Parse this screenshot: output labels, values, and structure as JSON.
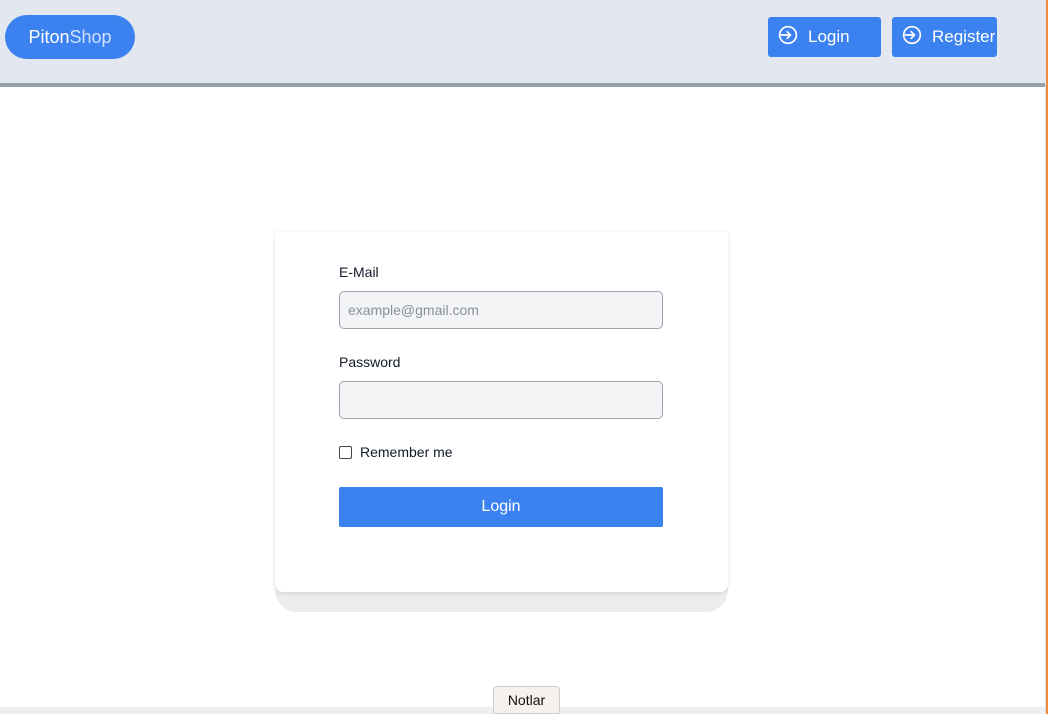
{
  "header": {
    "logo_part1": "Piton",
    "logo_part2": "Shop",
    "login_label": "Login",
    "register_label": "Register",
    "login_icon": "sign-in-icon",
    "register_icon": "sign-in-icon"
  },
  "form": {
    "email_label": "E-Mail",
    "email_placeholder": "example@gmail.com",
    "email_value": "",
    "password_label": "Password",
    "password_value": "",
    "remember_label": "Remember me",
    "remember_checked": false,
    "submit_label": "Login"
  },
  "footer": {
    "notes_label": "Notlar"
  },
  "colors": {
    "accent": "#3b82f0",
    "header_bg": "#e3e7ef",
    "header_border": "#939fab"
  }
}
